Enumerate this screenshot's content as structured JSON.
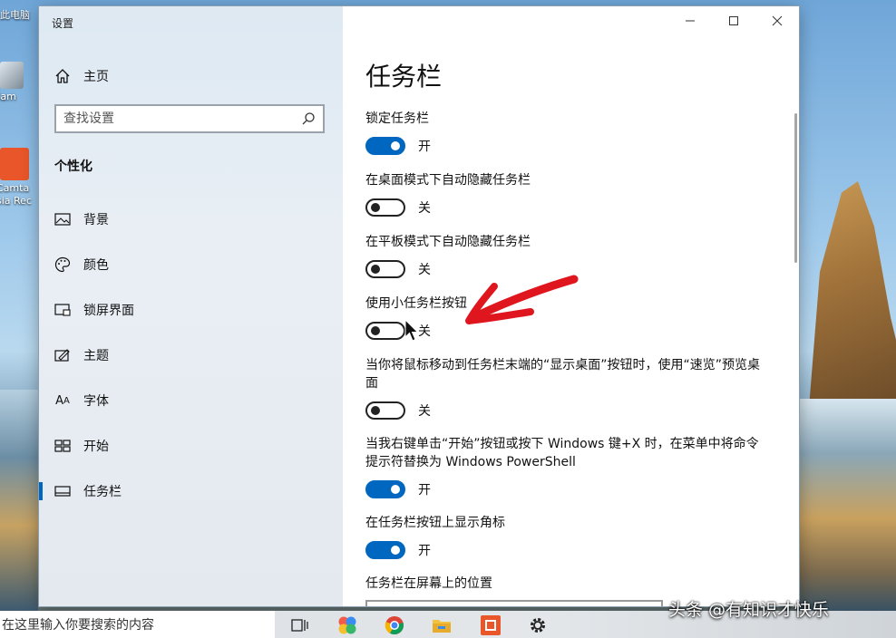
{
  "desktop": {
    "icons": [
      {
        "label": "此电脑"
      },
      {
        "label": "oCam"
      },
      {
        "label": "Camtasia Recorder"
      }
    ]
  },
  "window": {
    "title": "设置",
    "controls": {
      "minimize": "—",
      "maximize": "☐",
      "close": "✕"
    }
  },
  "sidebar": {
    "home_label": "主页",
    "search_placeholder": "查找设置",
    "section_title": "个性化",
    "items": [
      {
        "label": "背景",
        "icon": "image-icon"
      },
      {
        "label": "颜色",
        "icon": "palette-icon"
      },
      {
        "label": "锁屏界面",
        "icon": "lock-screen-icon"
      },
      {
        "label": "主题",
        "icon": "theme-icon"
      },
      {
        "label": "字体",
        "icon": "font-icon",
        "glyph": "A"
      },
      {
        "label": "开始",
        "icon": "start-icon"
      },
      {
        "label": "任务栏",
        "icon": "taskbar-icon",
        "active": true
      }
    ],
    "accent_color": "#0067c0"
  },
  "main": {
    "page_title": "任务栏",
    "settings": [
      {
        "label": "锁定任务栏",
        "state": "开",
        "on": true
      },
      {
        "label": "在桌面模式下自动隐藏任务栏",
        "state": "关",
        "on": false
      },
      {
        "label": "在平板模式下自动隐藏任务栏",
        "state": "关",
        "on": false
      },
      {
        "label": "使用小任务栏按钮",
        "state": "关",
        "on": false
      },
      {
        "label": "当你将鼠标移动到任务栏末端的“显示桌面”按钮时，使用“速览”预览桌面",
        "state": "关",
        "on": false
      },
      {
        "label": "当我右键单击“开始”按钮或按下 Windows 键+X 时，在菜单中将命令提示符替换为 Windows PowerShell",
        "state": "开",
        "on": true
      },
      {
        "label": "在任务栏按钮上显示角标",
        "state": "开",
        "on": true
      }
    ],
    "position_label": "任务栏在屏幕上的位置"
  },
  "taskbar": {
    "search_text": "在这里输入你要搜索的内容"
  },
  "watermark": "头条 @有知识才快乐"
}
